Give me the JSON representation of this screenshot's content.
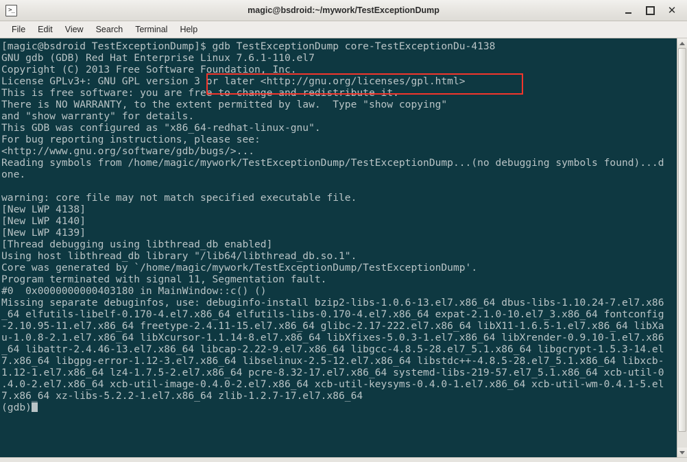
{
  "window": {
    "title": "magic@bsdroid:~/mywork/TestExceptionDump",
    "app_icon": "terminal-icon",
    "minimize_label": "",
    "maximize_label": "",
    "close_label": "✕"
  },
  "menubar": {
    "items": [
      {
        "label": "File"
      },
      {
        "label": "Edit"
      },
      {
        "label": "View"
      },
      {
        "label": "Search"
      },
      {
        "label": "Terminal"
      },
      {
        "label": "Help"
      }
    ]
  },
  "annotation": {
    "color": "#f4352b",
    "target_text": "gdb TestExceptionDump core-TestExceptionDu-4138"
  },
  "terminal": {
    "background": "#0e3841",
    "foreground": "#b9c4c6",
    "prompt": "[magic@bsdroid TestExceptionDump]$",
    "command": "gdb TestExceptionDump core-TestExceptionDu-4138",
    "gdb_prompt": "(gdb)",
    "lines": [
      "[magic@bsdroid TestExceptionDump]$ gdb TestExceptionDump core-TestExceptionDu-4138",
      "GNU gdb (GDB) Red Hat Enterprise Linux 7.6.1-110.el7",
      "Copyright (C) 2013 Free Software Foundation, Inc.",
      "License GPLv3+: GNU GPL version 3 or later <http://gnu.org/licenses/gpl.html>",
      "This is free software: you are free to change and redistribute it.",
      "There is NO WARRANTY, to the extent permitted by law.  Type \"show copying\"",
      "and \"show warranty\" for details.",
      "This GDB was configured as \"x86_64-redhat-linux-gnu\".",
      "For bug reporting instructions, please see:",
      "<http://www.gnu.org/software/gdb/bugs/>...",
      "Reading symbols from /home/magic/mywork/TestExceptionDump/TestExceptionDump...(no debugging symbols found)...d",
      "one.",
      "",
      "warning: core file may not match specified executable file.",
      "[New LWP 4138]",
      "[New LWP 4140]",
      "[New LWP 4139]",
      "[Thread debugging using libthread_db enabled]",
      "Using host libthread_db library \"/lib64/libthread_db.so.1\".",
      "Core was generated by `/home/magic/mywork/TestExceptionDump/TestExceptionDump'.",
      "Program terminated with signal 11, Segmentation fault.",
      "#0  0x0000000000403180 in MainWindow::c() ()",
      "Missing separate debuginfos, use: debuginfo-install bzip2-libs-1.0.6-13.el7.x86_64 dbus-libs-1.10.24-7.el7.x86",
      "_64 elfutils-libelf-0.170-4.el7.x86_64 elfutils-libs-0.170-4.el7.x86_64 expat-2.1.0-10.el7_3.x86_64 fontconfig",
      "-2.10.95-11.el7.x86_64 freetype-2.4.11-15.el7.x86_64 glibc-2.17-222.el7.x86_64 libX11-1.6.5-1.el7.x86_64 libXa",
      "u-1.0.8-2.1.el7.x86_64 libXcursor-1.1.14-8.el7.x86_64 libXfixes-5.0.3-1.el7.x86_64 libXrender-0.9.10-1.el7.x86",
      "_64 libattr-2.4.46-13.el7.x86_64 libcap-2.22-9.el7.x86_64 libgcc-4.8.5-28.el7_5.1.x86_64 libgcrypt-1.5.3-14.el",
      "7.x86_64 libgpg-error-1.12-3.el7.x86_64 libselinux-2.5-12.el7.x86_64 libstdc++-4.8.5-28.el7_5.1.x86_64 libxcb-",
      "1.12-1.el7.x86_64 lz4-1.7.5-2.el7.x86_64 pcre-8.32-17.el7.x86_64 systemd-libs-219-57.el7_5.1.x86_64 xcb-util-0",
      ".4.0-2.el7.x86_64 xcb-util-image-0.4.0-2.el7.x86_64 xcb-util-keysyms-0.4.0-1.el7.x86_64 xcb-util-wm-0.4.1-5.el",
      "7.x86_64 xz-libs-5.2.2-1.el7.x86_64 zlib-1.2.7-17.el7.x86_64",
      "(gdb)"
    ]
  },
  "scrollbar": {
    "up_arrow": "scroll-up-arrow",
    "down_arrow": "scroll-down-arrow"
  }
}
